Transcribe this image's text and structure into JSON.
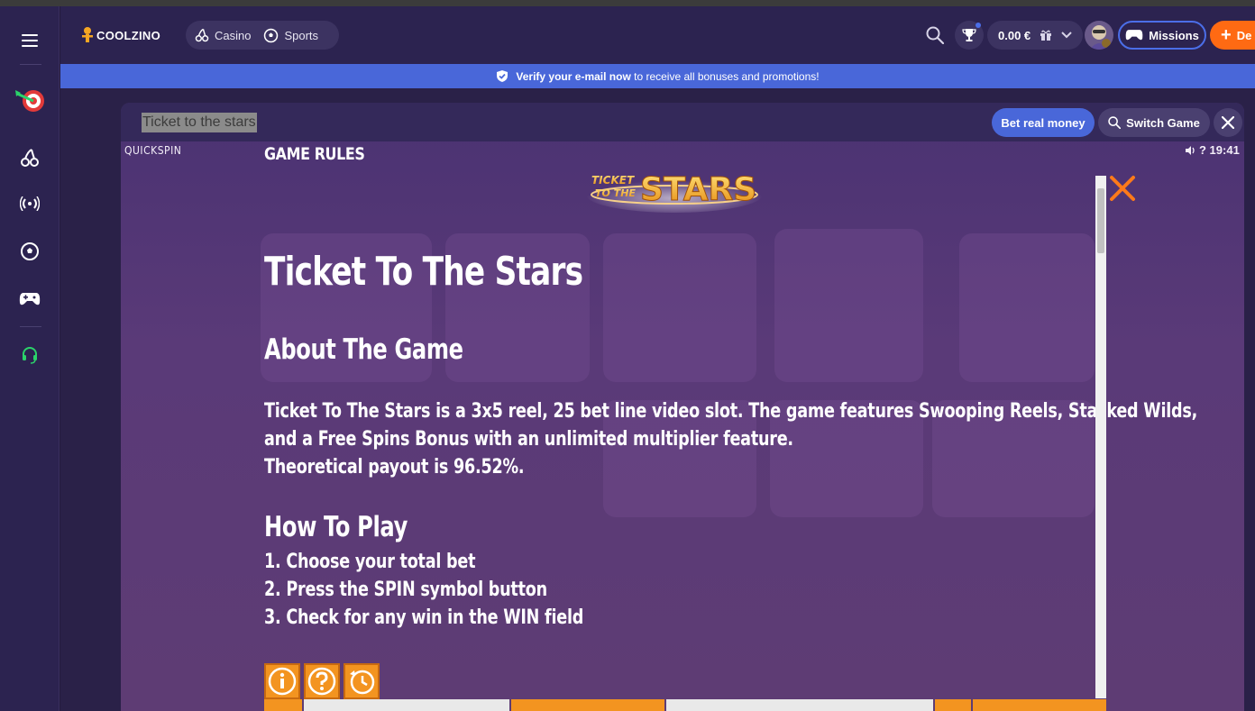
{
  "header": {
    "logo_text": "COOLZINO",
    "nav": [
      {
        "label": "Casino",
        "icon": "cherries-icon"
      },
      {
        "label": "Sports",
        "icon": "soccer-ball-icon"
      }
    ],
    "balance": "0.00 €",
    "missions_label": "Missions",
    "deposit_label": "De"
  },
  "banner": {
    "bold_text": "Verify your e-mail now",
    "text": "to receive all bonuses and promotions!"
  },
  "game": {
    "title": "Ticket to the stars",
    "bet_real_money": "Bet real money",
    "switch_game": "Switch Game",
    "provider": "QUICKSPIN",
    "status_text": "? 19:41",
    "logo_text": "TICKET TO THE STARS"
  },
  "rules": {
    "header": "GAME RULES",
    "title": "Ticket To The Stars",
    "about_heading": "About The Game",
    "about_lines": [
      "Ticket To The Stars is a 3x5 reel, 25 bet line video slot. The game features Swooping Reels, Stacked Wilds,",
      "and a Free Spins Bonus with an unlimited multiplier feature.",
      "Theoretical payout is 96.52%."
    ],
    "howto_heading": "How To Play",
    "howto_steps": [
      "1. Choose your total bet",
      "2. Press the SPIN symbol button",
      "3. Check for any win in the WIN field"
    ]
  },
  "colors": {
    "accent_blue": "#4967d9",
    "deposit_orange": "#ff6a13",
    "support_green": "#2bd36a",
    "close_orange": "#ff7a1a"
  }
}
